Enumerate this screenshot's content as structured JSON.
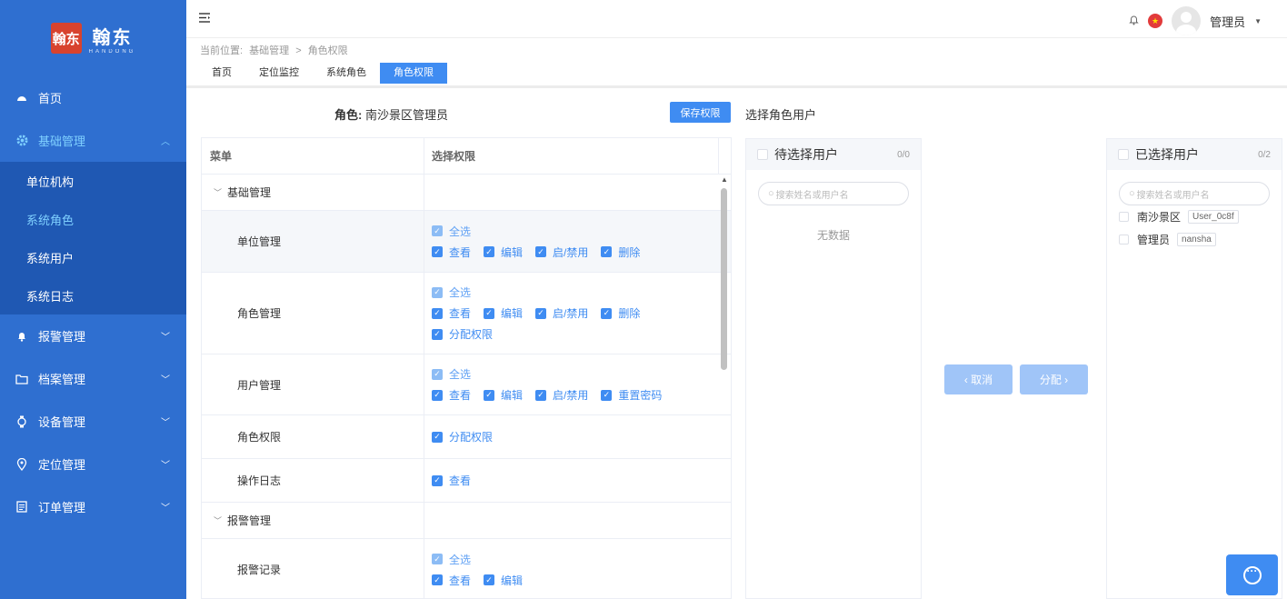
{
  "logo": {
    "cn": "翰东",
    "en": "HANDONG",
    "badge": "翰东"
  },
  "nav": {
    "home": "首页",
    "basic": "基础管理",
    "basic_children": [
      "单位机构",
      "系统角色",
      "系统用户",
      "系统日志"
    ],
    "alarm": "报警管理",
    "archive": "档案管理",
    "device": "设备管理",
    "location": "定位管理",
    "order": "订单管理"
  },
  "header": {
    "user": "管理员"
  },
  "breadcrumb": {
    "prefix": "当前位置:",
    "level1": "基础管理",
    "sep": ">",
    "level2": "角色权限"
  },
  "tabs": [
    "首页",
    "定位监控",
    "系统角色",
    "角色权限"
  ],
  "role": {
    "label": "角色:",
    "name": "南沙景区管理员"
  },
  "save_button": "保存权限",
  "select_users_title": "选择角色用户",
  "table": {
    "col_menu": "菜单",
    "col_perm": "选择权限",
    "group1": "基础管理",
    "group2": "报警管理",
    "rows": {
      "unit": "单位管理",
      "role": "角色管理",
      "user": "用户管理",
      "role_perm": "角色权限",
      "oplog": "操作日志",
      "alarm_record": "报警记录"
    },
    "perms": {
      "all": "全选",
      "view": "查看",
      "edit": "编辑",
      "toggle": "启/禁用",
      "delete": "删除",
      "assign": "分配权限",
      "reset_pwd": "重置密码"
    }
  },
  "transfer": {
    "left_title": "待选择用户",
    "left_count": "0/0",
    "right_title": "已选择用户",
    "right_count": "0/2",
    "search_placeholder": "搜索姓名或用户名",
    "empty": "无数据",
    "selected_users": [
      {
        "name": "南沙景区",
        "tag": "User_0c8f"
      },
      {
        "name": "管理员",
        "tag": "nansha"
      }
    ],
    "cancel_btn": "‹ 取消",
    "assign_btn": "分配 ›"
  }
}
